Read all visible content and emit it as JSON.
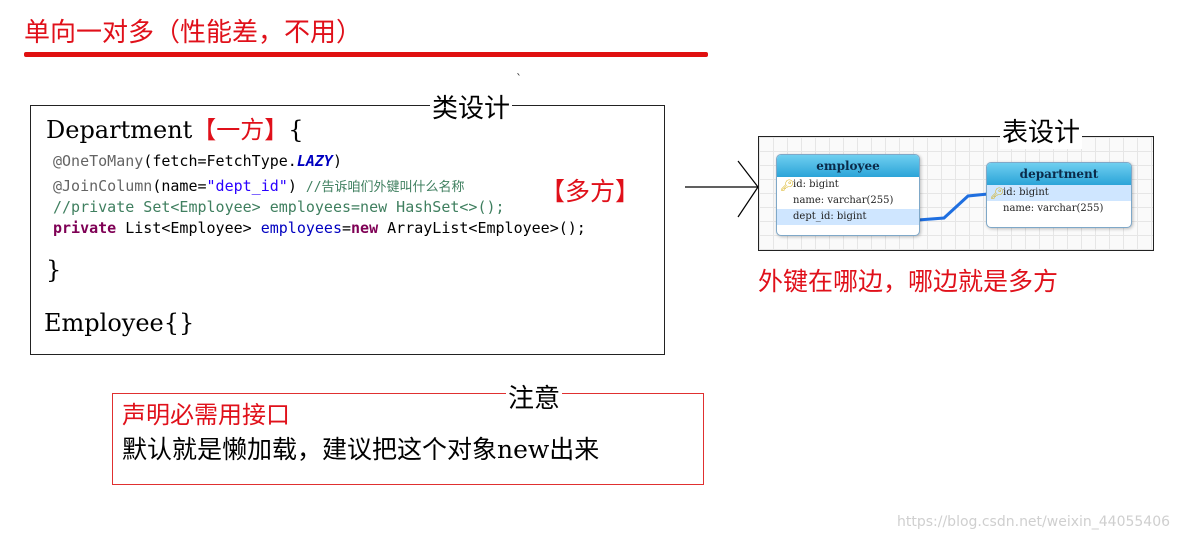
{
  "title": "单向一对多（性能差，不用）",
  "class_design": {
    "caption": "类设计",
    "dept_name": "Department",
    "one_side": "【一方】",
    "open_brace": "{",
    "line1": {
      "annotation": "@OneToMany",
      "prefix": "(fetch=FetchType.",
      "lazy": "LAZY",
      "suffix": ")"
    },
    "line2": {
      "annotation": "@JoinColumn",
      "prefix": "(name=",
      "value": "\"dept_id\"",
      "suffix": ") ",
      "comment": "//告诉咱们外键叫什么名称"
    },
    "line3": "//private Set<Employee> employees=new HashSet<>();",
    "line4": {
      "kw1": "private",
      "type": " List<Employee> ",
      "field": "employees",
      "eq": "=",
      "kw2": "new",
      "rest": " ArrayList<Employee>();"
    },
    "many_side": "【多方】",
    "close_brace": "}",
    "employee": "Employee{}"
  },
  "table_design": {
    "caption": "表设计",
    "employee_table": {
      "name": "employee",
      "columns": [
        "id: bigint",
        "name: varchar(255)",
        "dept_id: bigint"
      ]
    },
    "department_table": {
      "name": "department",
      "columns": [
        "id: bigint",
        "name: varchar(255)"
      ]
    },
    "foreign_key_note": "外键在哪边，哪边就是多方"
  },
  "note": {
    "caption": "注意",
    "line1": "声明必需用接口",
    "line2": "默认就是懒加载，建议把这个对象new出来"
  },
  "watermark": "https://blog.csdn.net/weixin_44055406",
  "colors": {
    "accent_red": "#e0101a",
    "entity_header": "#2ba4d8",
    "relation_line": "#1f6fe0"
  }
}
